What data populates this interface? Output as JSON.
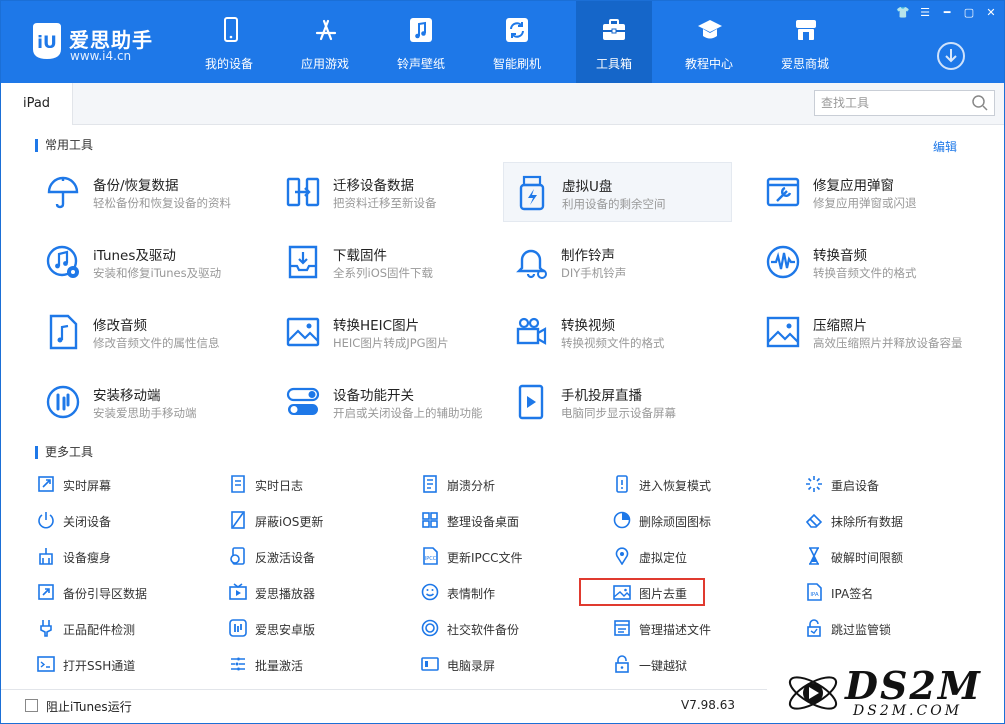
{
  "app": {
    "title": "爱思助手",
    "url": "www.i4.cn"
  },
  "nav": [
    {
      "label": "我的设备",
      "icon": "phone-icon"
    },
    {
      "label": "应用游戏",
      "icon": "app-store-icon"
    },
    {
      "label": "铃声壁纸",
      "icon": "music-note-icon"
    },
    {
      "label": "智能刷机",
      "icon": "flash-icon"
    },
    {
      "label": "工具箱",
      "icon": "toolbox-icon",
      "active": true
    },
    {
      "label": "教程中心",
      "icon": "graduation-cap-icon"
    },
    {
      "label": "爱思商城",
      "icon": "shop-icon"
    }
  ],
  "tab": {
    "device": "iPad"
  },
  "search": {
    "placeholder": "查找工具"
  },
  "common": {
    "title": "常用工具",
    "edit": "编辑",
    "items": [
      {
        "title": "备份/恢复数据",
        "desc": "轻松备份和恢复设备的资料",
        "icon": "umbrella-icon"
      },
      {
        "title": "迁移设备数据",
        "desc": "把资料迁移至新设备",
        "icon": "transfer-icon"
      },
      {
        "title": "虚拟U盘",
        "desc": "利用设备的剩余空间",
        "icon": "usb-drive-icon"
      },
      {
        "title": "修复应用弹窗",
        "desc": "修复应用弹窗或闪退",
        "icon": "wrench-window-icon"
      },
      {
        "title": "iTunes及驱动",
        "desc": "安装和修复iTunes及驱动",
        "icon": "itunes-icon"
      },
      {
        "title": "下载固件",
        "desc": "全系列iOS固件下载",
        "icon": "firmware-download-icon"
      },
      {
        "title": "制作铃声",
        "desc": "DIY手机铃声",
        "icon": "bell-icon"
      },
      {
        "title": "转换音频",
        "desc": "转换音频文件的格式",
        "icon": "audio-wave-icon"
      },
      {
        "title": "修改音频",
        "desc": "修改音频文件的属性信息",
        "icon": "audio-file-icon"
      },
      {
        "title": "转换HEIC图片",
        "desc": "HEIC图片转成JPG图片",
        "icon": "image-convert-icon"
      },
      {
        "title": "转换视频",
        "desc": "转换视频文件的格式",
        "icon": "video-convert-icon"
      },
      {
        "title": "压缩照片",
        "desc": "高效压缩照片并释放设备容量",
        "icon": "photo-compress-icon"
      },
      {
        "title": "安装移动端",
        "desc": "安装爱思助手移动端",
        "icon": "i4-mobile-icon"
      },
      {
        "title": "设备功能开关",
        "desc": "开启或关闭设备上的辅助功能",
        "icon": "toggle-icon"
      },
      {
        "title": "手机投屏直播",
        "desc": "电脑同步显示设备屏幕",
        "icon": "screen-cast-icon"
      }
    ]
  },
  "more": {
    "title": "更多工具",
    "items": [
      {
        "label": "实时屏幕",
        "icon": "expand-screen-icon"
      },
      {
        "label": "实时日志",
        "icon": "log-icon"
      },
      {
        "label": "崩溃分析",
        "icon": "crash-report-icon"
      },
      {
        "label": "进入恢复模式",
        "icon": "recovery-mode-icon"
      },
      {
        "label": "重启设备",
        "icon": "restart-icon"
      },
      {
        "label": "关闭设备",
        "icon": "power-icon"
      },
      {
        "label": "屏蔽iOS更新",
        "icon": "block-update-icon"
      },
      {
        "label": "整理设备桌面",
        "icon": "grid-icon"
      },
      {
        "label": "删除顽固图标",
        "icon": "pie-icon"
      },
      {
        "label": "抹除所有数据",
        "icon": "eraser-icon"
      },
      {
        "label": "设备瘦身",
        "icon": "broom-icon"
      },
      {
        "label": "反激活设备",
        "icon": "deactivate-icon"
      },
      {
        "label": "更新IPCC文件",
        "icon": "ipcc-file-icon"
      },
      {
        "label": "虚拟定位",
        "icon": "location-pin-icon"
      },
      {
        "label": "破解时间限额",
        "icon": "hourglass-icon"
      },
      {
        "label": "备份引导区数据",
        "icon": "backup-boot-icon"
      },
      {
        "label": "爱思播放器",
        "icon": "tv-player-icon"
      },
      {
        "label": "表情制作",
        "icon": "smiley-icon"
      },
      {
        "label": "图片去重",
        "icon": "image-dedup-icon",
        "boxed": true
      },
      {
        "label": "IPA签名",
        "icon": "ipa-file-icon"
      },
      {
        "label": "正品配件检测",
        "icon": "cable-check-icon"
      },
      {
        "label": "爱思安卓版",
        "icon": "i4-android-icon"
      },
      {
        "label": "社交软件备份",
        "icon": "social-backup-icon"
      },
      {
        "label": "管理描述文件",
        "icon": "profile-icon"
      },
      {
        "label": "跳过监管锁",
        "icon": "supervision-lock-icon"
      },
      {
        "label": "打开SSH通道",
        "icon": "terminal-icon"
      },
      {
        "label": "批量激活",
        "icon": "batch-activate-icon"
      },
      {
        "label": "电脑录屏",
        "icon": "screen-record-icon"
      },
      {
        "label": "一键越狱",
        "icon": "unlock-icon"
      },
      {
        "label": "",
        "icon": ""
      }
    ]
  },
  "footer": {
    "block_itunes": "阻止iTunes运行",
    "version": "V7.98.63"
  },
  "watermark": {
    "main": "DS2M",
    "sub": "DS2M.COM"
  },
  "colors": {
    "accent": "#1e78e8",
    "highlight_box": "#e03a2f"
  }
}
